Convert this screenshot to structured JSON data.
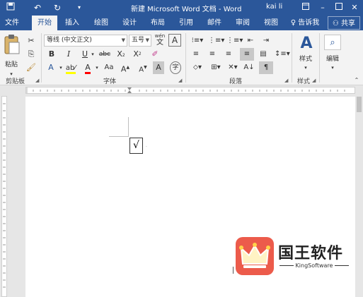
{
  "window": {
    "title": "新建 Microsoft Word 文档  -  Word",
    "user": "kai li",
    "save_icon": "save-icon",
    "undo_icon": "undo-icon",
    "redo_icon": "redo-icon",
    "customize_icon": "customize-icon"
  },
  "tabs": [
    {
      "label": "文件"
    },
    {
      "label": "开始"
    },
    {
      "label": "插入"
    },
    {
      "label": "绘图"
    },
    {
      "label": "设计"
    },
    {
      "label": "布局"
    },
    {
      "label": "引用"
    },
    {
      "label": "邮件"
    },
    {
      "label": "审阅"
    },
    {
      "label": "视图"
    }
  ],
  "tell_me": "告诉我",
  "share": "共享",
  "ribbon": {
    "clipboard": {
      "label": "剪贴板",
      "paste": "粘贴"
    },
    "font": {
      "label": "字体",
      "font_name": "等线 (中文正文)",
      "font_size": "五号",
      "wen_top": "wén",
      "wen_bottom": "文",
      "aa": "Aa"
    },
    "paragraph": {
      "label": "段落"
    },
    "styles": {
      "label": "样式",
      "button": "样式"
    },
    "editing": {
      "label": "",
      "button": "编辑"
    }
  },
  "document": {
    "check_char": "√",
    "paragraph_mark": "↵"
  },
  "watermark": {
    "title": "国王软件",
    "subtitle": "KingSoftware"
  },
  "colors": {
    "accent": "#2b579a",
    "highlight": "#ffff00",
    "font_color": "#ff0000",
    "logo": "#ec5b4b"
  }
}
